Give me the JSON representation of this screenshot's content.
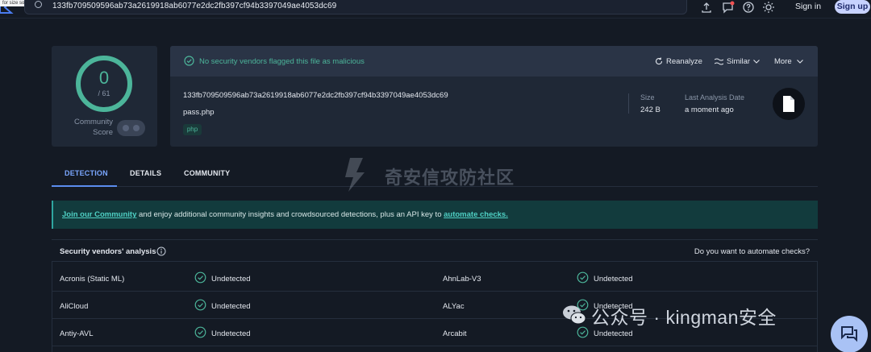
{
  "topbar": {
    "search_value": "133fb709509596ab73a2619918ab6077e2dc2fb397cf94b3397049ae4053dc69",
    "corner_tip": "for size sound",
    "signin": "Sign in",
    "signup": "Sign up"
  },
  "score": {
    "detections": "0",
    "total": "/ 61",
    "community_label_line1": "Community",
    "community_label_line2": "Score",
    "ring_color": "#4cb59a"
  },
  "summary": {
    "status": "No security vendors flagged this file as malicious",
    "actions": {
      "reanalyze": "Reanalyze",
      "similar": "Similar",
      "more": "More"
    },
    "hash": "133fb709509596ab73a2619918ab6077e2dc2fb397cf94b3397049ae4053dc69",
    "filename": "pass.php",
    "tag": "php",
    "size_label": "Size",
    "size_value": "242 B",
    "last_analysis_label": "Last Analysis Date",
    "last_analysis_value": "a moment ago"
  },
  "tabs": [
    {
      "label": "DETECTION",
      "active": true
    },
    {
      "label": "DETAILS",
      "active": false
    },
    {
      "label": "COMMUNITY",
      "active": false
    }
  ],
  "banner": {
    "link1": "Join our Community",
    "middle": " and enjoy additional community insights and crowdsourced detections, plus an API key to ",
    "link2": "automate checks."
  },
  "vendors": {
    "title": "Security vendors' analysis",
    "automate_question": "Do you want to automate checks?",
    "rows": [
      {
        "left_name": "Acronis (Static ML)",
        "left_result": "Undetected",
        "right_name": "AhnLab-V3",
        "right_result": "Undetected"
      },
      {
        "left_name": "AliCloud",
        "left_result": "Undetected",
        "right_name": "ALYac",
        "right_result": "Undetected"
      },
      {
        "left_name": "Antiy-AVL",
        "left_result": "Undetected",
        "right_name": "Arcabit",
        "right_result": "Undetected"
      }
    ]
  },
  "watermarks": {
    "center": "奇安信攻防社区",
    "bottom": "公众号 · kingman安全"
  },
  "colors": {
    "accent_green": "#4cb59a",
    "accent_blue": "#5b8def",
    "banner_bg": "#123b3d"
  }
}
